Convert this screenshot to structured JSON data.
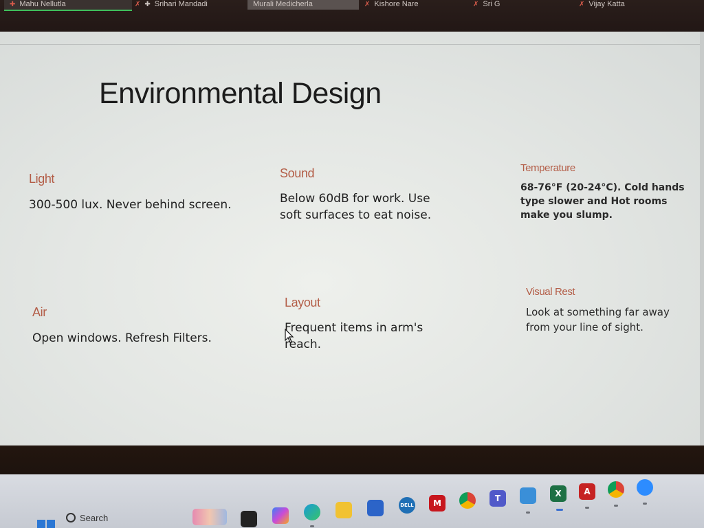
{
  "participants": [
    {
      "name": "Mahu Nellutla",
      "active": true
    },
    {
      "name": "Srihari Mandadi"
    },
    {
      "name": "Murali Medicherla"
    },
    {
      "name": "Kishore Nare"
    },
    {
      "name": "Sri G"
    },
    {
      "name": "Vijay Katta"
    }
  ],
  "slide": {
    "title": "Environmental Design",
    "cards": [
      {
        "heading": "Light",
        "body": "300-500 lux. Never behind screen."
      },
      {
        "heading": "Sound",
        "body": "Below 60dB for work. Use soft surfaces to eat noise."
      },
      {
        "heading": "Temperature",
        "body": "68-76°F (20-24°C). Cold hands type slower and Hot rooms make you slump."
      },
      {
        "heading": "Air",
        "body": "Open windows. Refresh Filters."
      },
      {
        "heading": "Layout",
        "body": "Frequent items in arm's reach."
      },
      {
        "heading": "Visual Rest",
        "body": "Look at something far away from your line of sight."
      }
    ]
  },
  "taskbar": {
    "search_label": "Search",
    "icons": [
      "start-icon",
      "widgets-icon",
      "task-view-icon",
      "copilot-icon",
      "edge-icon",
      "file-explorer-icon",
      "store-icon",
      "dell-icon",
      "mcafee-icon",
      "chrome-icon",
      "teams-icon",
      "notepad-icon",
      "excel-icon",
      "acrobat-icon",
      "chrome-profile-icon",
      "app-icon"
    ]
  },
  "colors": {
    "accent": "#b35d47",
    "title": "#1c1c1c",
    "body": "#202020"
  }
}
